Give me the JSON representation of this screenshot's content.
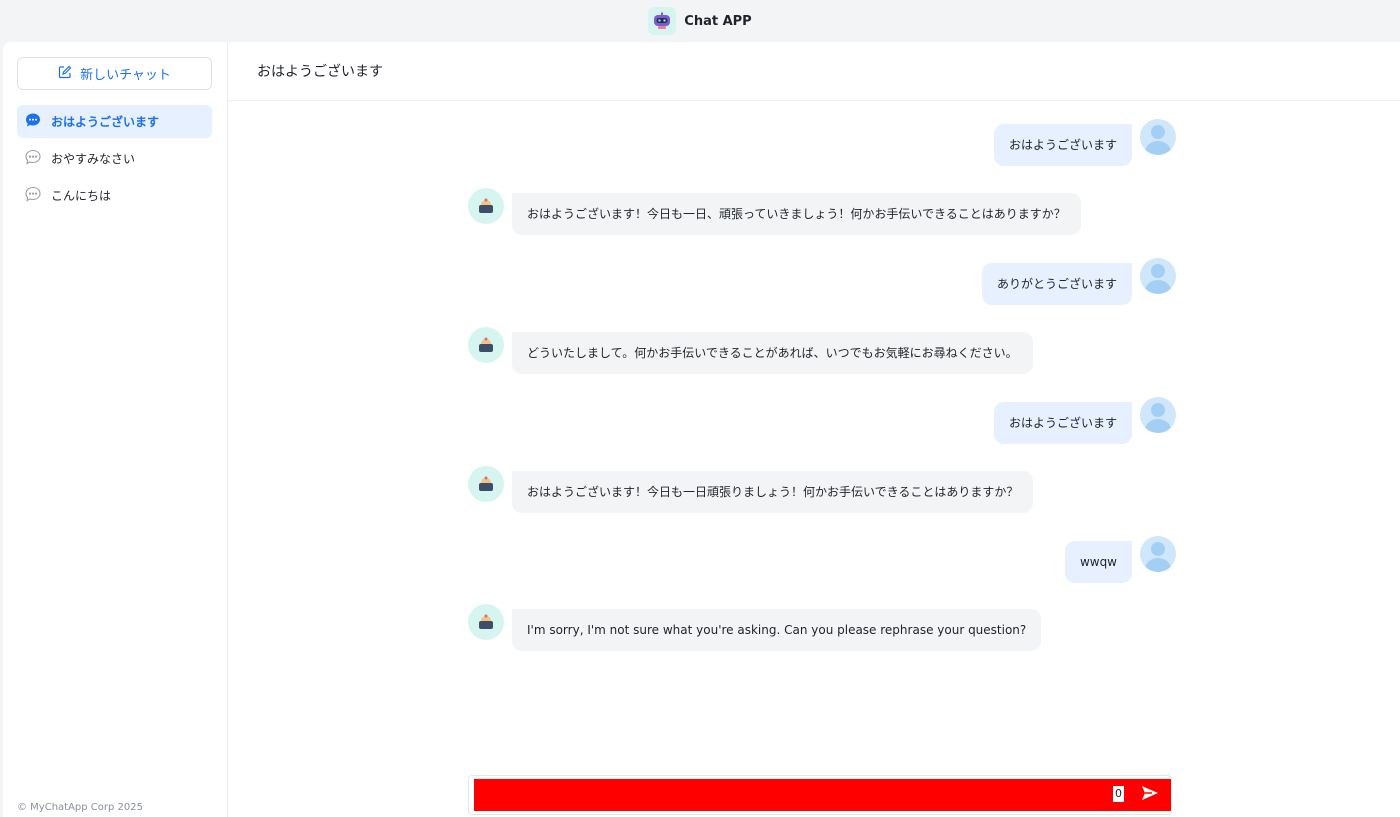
{
  "app": {
    "title": "Chat APP"
  },
  "sidebar": {
    "new_chat_label": "新しいチャット",
    "conversations": [
      {
        "label": "おはようございます",
        "active": true
      },
      {
        "label": "おやすみなさい",
        "active": false
      },
      {
        "label": "こんにちは",
        "active": false
      }
    ],
    "copyright": "© MyChatApp Corp 2025"
  },
  "chat": {
    "title": "おはようございます",
    "messages": [
      {
        "role": "user",
        "text": "おはようございます"
      },
      {
        "role": "bot",
        "text": "おはようございます！今日も一日、頑張っていきましょう！何かお手伝いできることはありますか？"
      },
      {
        "role": "user",
        "text": "ありがとうございます"
      },
      {
        "role": "bot",
        "text": "どういたしまして。何かお手伝いできることがあれば、いつでもお気軽にお尋ねください。"
      },
      {
        "role": "user",
        "text": "おはようございます"
      },
      {
        "role": "bot",
        "text": "おはようございます！今日も一日頑張りましょう！何かお手伝いできることはありますか？"
      },
      {
        "role": "user",
        "text": "wwqw"
      },
      {
        "role": "bot",
        "text": "I'm sorry, I'm not sure what you're asking. Can you please rephrase your question?"
      }
    ]
  },
  "composer": {
    "value": "",
    "char_count": "0"
  },
  "colors": {
    "accent": "#1d6ff2",
    "user_bubble": "#e6f0ff",
    "bot_bubble": "#f3f4f6",
    "composer_fill": "#ff0000"
  },
  "icons": {
    "app_logo": "robot-icon",
    "new_chat": "edit-icon",
    "conversation": "chat-bubble-icon",
    "send": "send-arrow-icon"
  }
}
